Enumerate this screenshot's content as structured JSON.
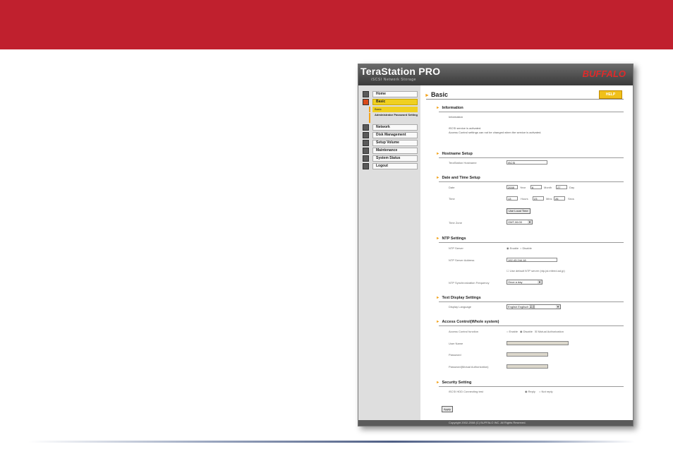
{
  "app": {
    "logo": "TeraStation PRO",
    "logo_sub": "iSCSI Network Storage",
    "brand": "BUFFALO",
    "footer": "Copyright 2002-2008 (C) BUFFALO INC. All Rights Reserved."
  },
  "sidebar": {
    "items": [
      {
        "label": "Home"
      },
      {
        "label": "Basic",
        "active": true
      },
      {
        "label": "Network"
      },
      {
        "label": "Disk Management"
      },
      {
        "label": "Setup Volume"
      },
      {
        "label": "Maintenance"
      },
      {
        "label": "System Status"
      },
      {
        "label": "Logout"
      }
    ],
    "subitems": [
      {
        "label": "Basic",
        "active": true
      },
      {
        "label": "Administrator Password Setting"
      }
    ]
  },
  "page": {
    "title": "Basic",
    "help_label": "HELP",
    "information": {
      "title": "Information",
      "label": "Information",
      "line1": "iSCSI service is activated.",
      "line2": "Access Control settings can not be changed when the service is activated."
    },
    "hostname": {
      "title": "Hostname Setup",
      "label": "TeraStation Hostname",
      "value": "iSCSI"
    },
    "datetime": {
      "title": "Date and Time Setup",
      "date_label": "Date",
      "year": "2008",
      "year_unit": "Year",
      "month": "6",
      "month_unit": "Month",
      "day": "27",
      "day_unit": "Day",
      "time_label": "Time",
      "hours": "13",
      "hours_unit": "Hours",
      "mins": "23",
      "mins_unit": "Mins",
      "secs": "26",
      "secs_unit": "Secs",
      "local_time_button": "Use Local Time",
      "timezone_label": "Time Zone",
      "timezone_value": "GMT-06:00"
    },
    "ntp": {
      "title": "NTP Settings",
      "server_label": "NTP Server",
      "enable": "Enable",
      "disable": "Disable",
      "address_label": "NTP Server Address",
      "address_value": "192.43.244.18",
      "default_checkbox": "Use default NTP server (ntp.jst.mfeed.ad.jp)",
      "freq_label": "NTP Synchronization Frequency",
      "freq_value": "Once a day"
    },
    "text_display": {
      "title": "Text Display Settings",
      "lang_label": "Display Language",
      "lang_value": "English Englisch 英語"
    },
    "access": {
      "title": "Access Control(Whole system)",
      "function_label": "Access Control function",
      "enable": "Enable",
      "disable": "Disable",
      "mutual": "Mutual Authorization",
      "user_label": "User Name",
      "password_label": "Password",
      "mutual_password_label": "Password(Mutual Authorization)"
    },
    "security": {
      "title": "Security Setting",
      "label": "iSCSI HDD Connecting test",
      "reply": "Reply",
      "not_reply": "Not reply"
    },
    "apply_label": "Apply"
  }
}
